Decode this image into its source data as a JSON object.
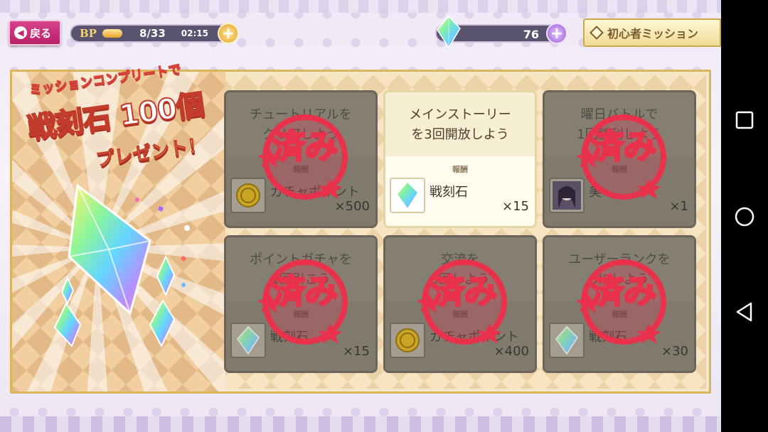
{
  "header": {
    "back_label": "戻る",
    "bp_label": "BP",
    "bp_value": "8/33",
    "bp_timer": "02:15",
    "stone_count": "76",
    "beginner_mission_label": "初心者ミッション"
  },
  "promo": {
    "line1": "ミッションコンプリートで",
    "line2": "戦刻石 100個",
    "line3": "プレゼント！"
  },
  "missions": [
    {
      "title": "チュートリアルを\nクリアしよう",
      "reward_label": "報酬",
      "item": "ガチャポイント",
      "qty": "×500",
      "status": "済み"
    },
    {
      "title": "メインストーリー\nを3回開放しよう",
      "reward_label": "報酬",
      "item": "戦刻石",
      "qty": "×15",
      "status": ""
    },
    {
      "title": "曜日バトルで\n1回勝利しよう",
      "reward_label": "報酬",
      "item": "美",
      "qty": "×1",
      "status": "済み"
    },
    {
      "title": "ポイントガチャを\n1回引こう",
      "reward_label": "報酬",
      "item": "戦刻石",
      "qty": "×15",
      "status": "済み"
    },
    {
      "title": "交流を\n3回しよう",
      "reward_label": "報酬",
      "item": "ガチャポイント",
      "qty": "×400",
      "status": "済み"
    },
    {
      "title": "ユーザーランクを\n5にしよう",
      "reward_label": "報酬",
      "item": "戦刻石",
      "qty": "×30",
      "status": "済み"
    }
  ],
  "colors": {
    "accent_pink": "#c0276f",
    "gold": "#d9b65c",
    "stamp_red": "#e8314a"
  },
  "icons": [
    "back-arrow-icon",
    "plus-icon",
    "crystal-icon",
    "coin-icon",
    "character-portrait-icon",
    "square-nav-icon",
    "circle-nav-icon",
    "triangle-nav-icon"
  ]
}
